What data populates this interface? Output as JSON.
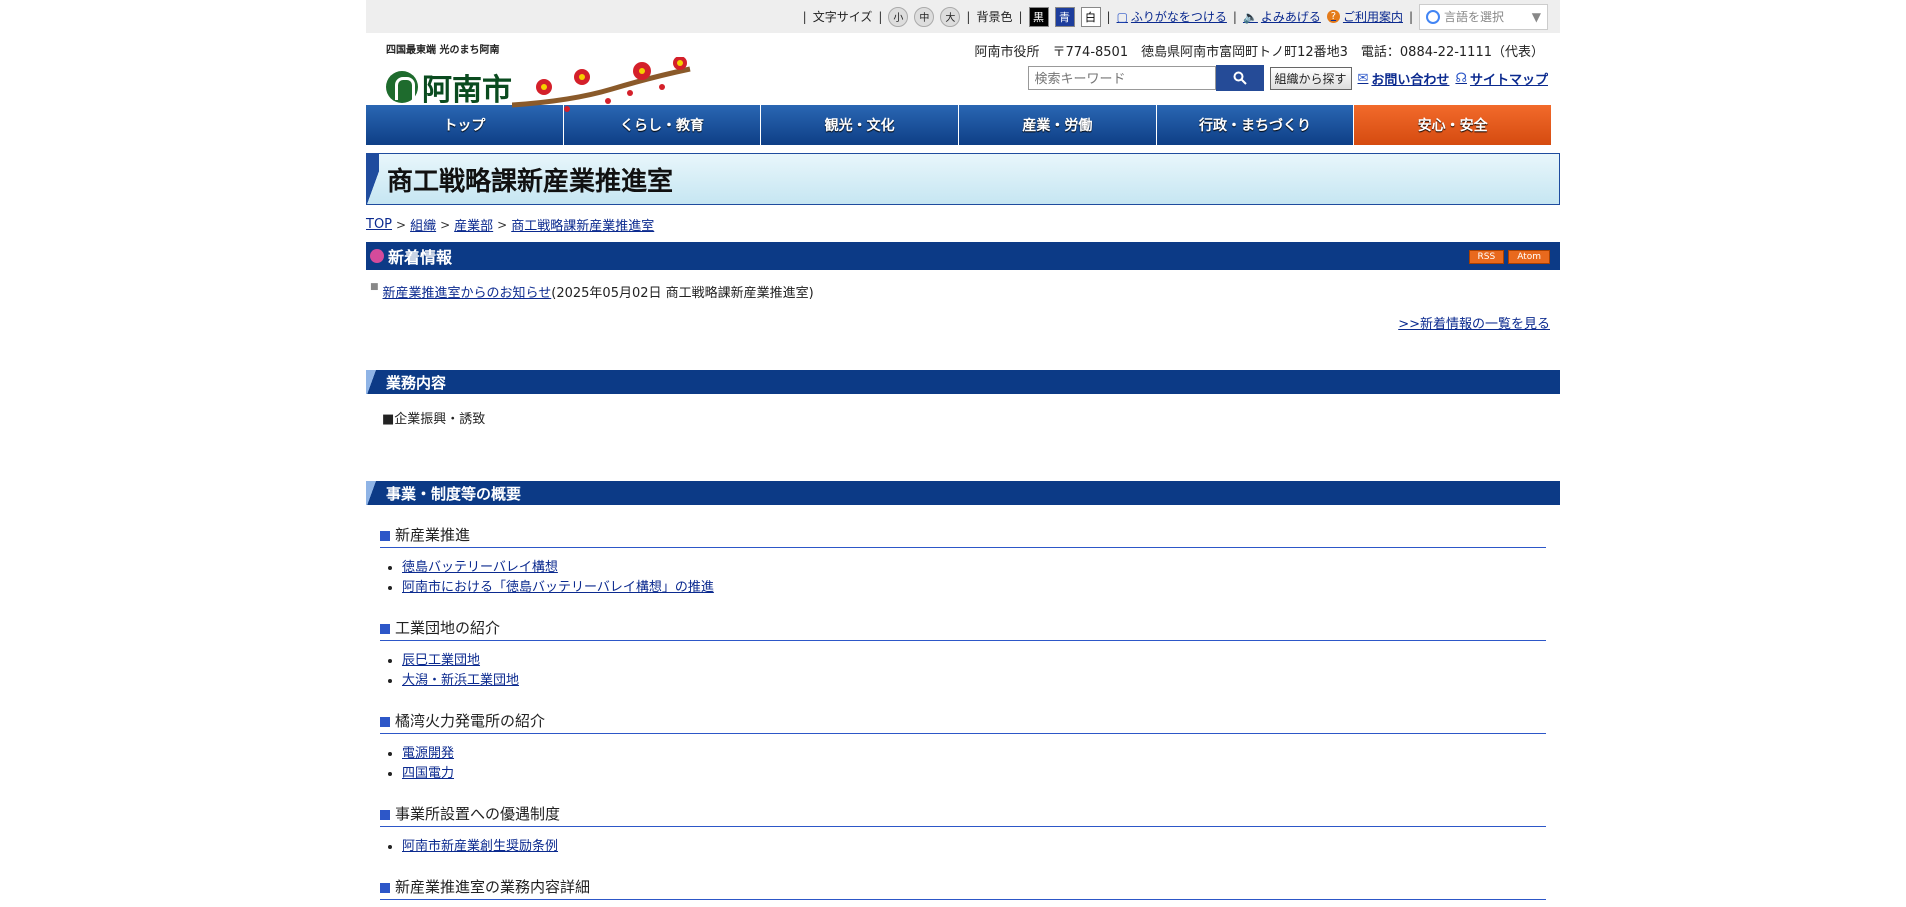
{
  "util": {
    "font_size_label": "文字サイズ",
    "font_small": "小",
    "font_mid": "中",
    "font_large": "大",
    "bg_label": "背景色",
    "bg_black": "黒",
    "bg_blue": "青",
    "bg_white": "白",
    "furigana": "ふりがなをつける",
    "read_aloud": "よみあげる",
    "guide": "ご利用案内",
    "translate": "言語を選択"
  },
  "header": {
    "logo_sub": "四国最東端 光のまち阿南",
    "logo_text": "阿南市",
    "address": "阿南市役所　〒774-8501　徳島県阿南市富岡町トノ町12番地3　電話：0884-22-1111（代表）",
    "search_placeholder": "検索キーワード",
    "org_search": "組織から探す",
    "contact": "お問い合わせ",
    "sitemap": "サイトマップ"
  },
  "nav": [
    "トップ",
    "くらし・教育",
    "観光・文化",
    "産業・労働",
    "行政・まちづくり",
    "安心・安全"
  ],
  "page_title": "商工戦略課新産業推進室",
  "breadcrumb": [
    "TOP",
    "組織",
    "産業部",
    "商工戦略課新産業推進室"
  ],
  "news": {
    "heading": "新着情報",
    "rss": "RSS",
    "atom": "Atom",
    "item_link": "新産業推進室からのお知らせ",
    "item_meta": "(2025年05月02日 商工戦略課新産業推進室)",
    "more": ">>新着情報の一覧を見る"
  },
  "business": {
    "heading": "業務内容",
    "text": "■企業振興・誘致"
  },
  "overview": {
    "heading": "事業・制度等の概要",
    "sections": [
      {
        "title": "新産業推進",
        "links": [
          "徳島バッテリーバレイ構想",
          "阿南市における「徳島バッテリーバレイ構想」の推進"
        ]
      },
      {
        "title": "工業団地の紹介",
        "links": [
          "辰巳工業団地",
          "大潟・新浜工業団地"
        ]
      },
      {
        "title": "橘湾火力発電所の紹介",
        "links": [
          "電源開発",
          "四国電力"
        ]
      },
      {
        "title": "事業所設置への優遇制度",
        "links": [
          "阿南市新産業創生奨励条例"
        ]
      },
      {
        "title": "新産業推進室の業務内容詳細",
        "links": []
      }
    ]
  }
}
